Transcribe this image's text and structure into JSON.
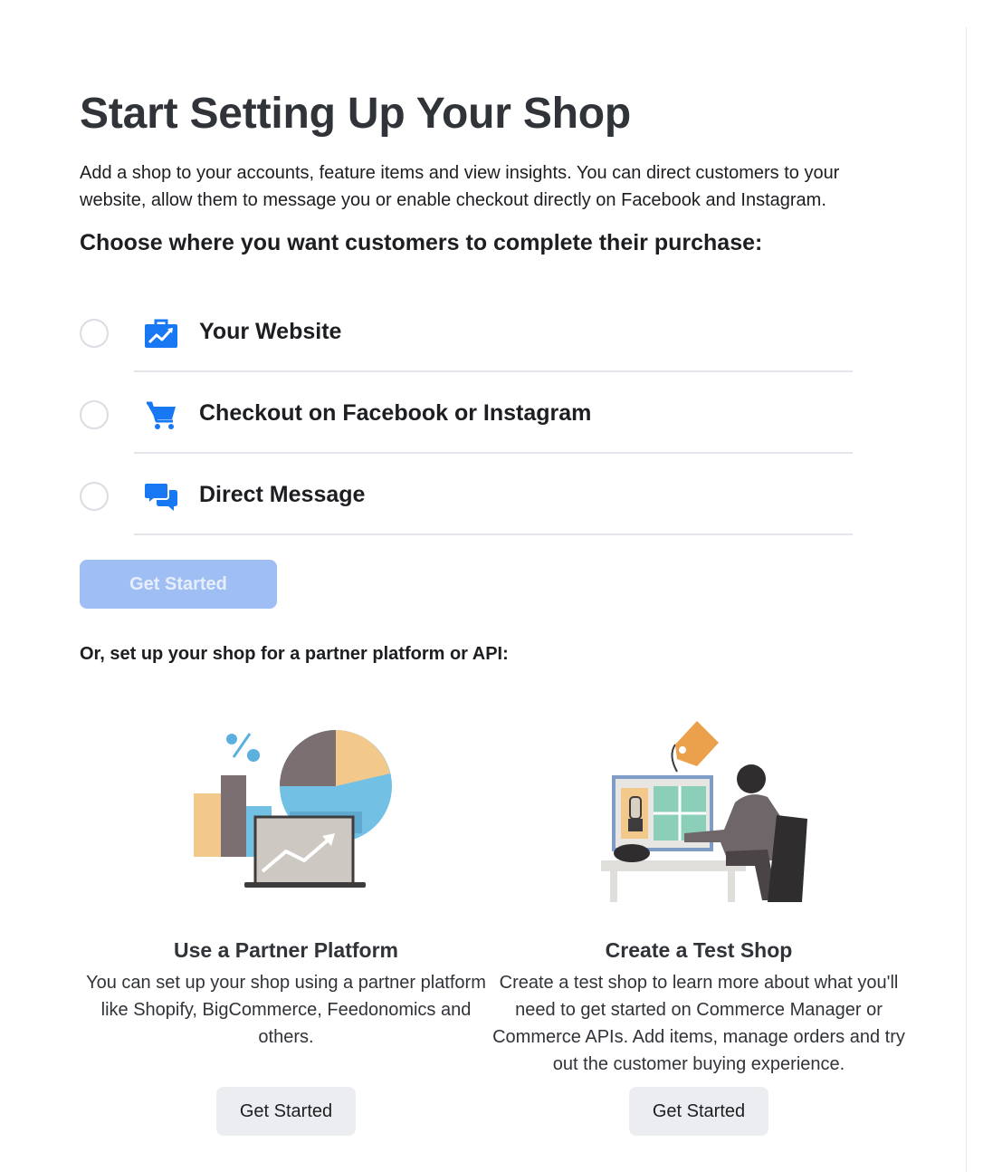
{
  "page": {
    "title": "Start Setting Up Your Shop",
    "intro": "Add a shop to your accounts, feature items and view insights. You can direct customers to your website, allow them to message you or enable checkout directly on Facebook and Instagram.",
    "choose_heading": "Choose where you want customers to complete their purchase:"
  },
  "options": [
    {
      "label": "Your Website",
      "icon": "briefcase-chart-icon",
      "selected": false
    },
    {
      "label": "Checkout on Facebook or Instagram",
      "icon": "shopping-cart-icon",
      "selected": false
    },
    {
      "label": "Direct Message",
      "icon": "chat-bubbles-icon",
      "selected": false
    }
  ],
  "primary_button": {
    "label": "Get Started",
    "disabled": true
  },
  "partner": {
    "heading": "Or, set up your shop for a partner platform or API:",
    "cards": [
      {
        "title": "Use a Partner Platform",
        "description": "You can set up your shop using a partner platform like Shopify, BigCommerce, Feedonomics and others.",
        "button": "Get Started"
      },
      {
        "title": "Create a Test Shop",
        "description": "Create a test shop to learn more about what you'll need to get started on Commerce Manager or Commerce APIs. Add items, manage orders and try out the customer buying experience.",
        "button": "Get Started"
      }
    ]
  },
  "colors": {
    "accent_blue": "#1877f2",
    "disabled_button_bg": "#9fbef3",
    "secondary_button_bg": "#ebedf0",
    "divider": "#e4e6eb"
  }
}
